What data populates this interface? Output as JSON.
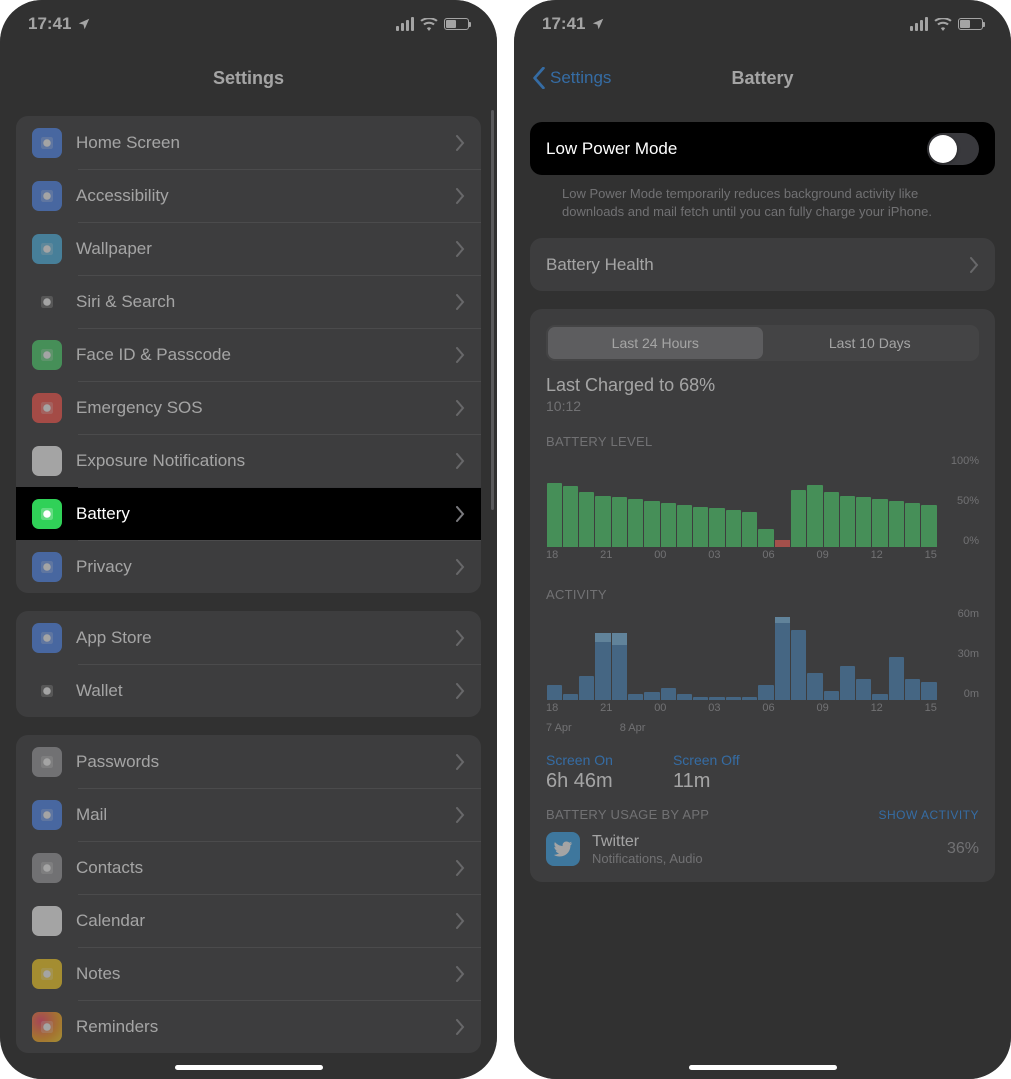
{
  "status": {
    "time": "17:41"
  },
  "left": {
    "title": "Settings",
    "groups": [
      [
        {
          "label": "Home Screen",
          "iconName": "home-screen-icon",
          "iconClass": "ic-blue",
          "selected": false
        },
        {
          "label": "Accessibility",
          "iconName": "accessibility-icon",
          "iconClass": "ic-blue",
          "selected": false
        },
        {
          "label": "Wallpaper",
          "iconName": "wallpaper-icon",
          "iconClass": "ic-cyan",
          "selected": false
        },
        {
          "label": "Siri & Search",
          "iconName": "siri-icon",
          "iconClass": "ic-dark",
          "selected": false
        },
        {
          "label": "Face ID & Passcode",
          "iconName": "faceid-icon",
          "iconClass": "ic-green",
          "selected": false
        },
        {
          "label": "Emergency SOS",
          "iconName": "sos-icon",
          "iconClass": "ic-red",
          "selected": false
        },
        {
          "label": "Exposure Notifications",
          "iconName": "exposure-icon",
          "iconClass": "ic-white",
          "selected": false
        },
        {
          "label": "Battery",
          "iconName": "battery-icon",
          "iconClass": "ic-green",
          "selected": true
        },
        {
          "label": "Privacy",
          "iconName": "privacy-icon",
          "iconClass": "ic-blue",
          "selected": false
        }
      ],
      [
        {
          "label": "App Store",
          "iconName": "appstore-icon",
          "iconClass": "ic-blue",
          "selected": false
        },
        {
          "label": "Wallet",
          "iconName": "wallet-icon",
          "iconClass": "ic-dark",
          "selected": false
        }
      ],
      [
        {
          "label": "Passwords",
          "iconName": "passwords-icon",
          "iconClass": "ic-grey",
          "selected": false
        },
        {
          "label": "Mail",
          "iconName": "mail-icon",
          "iconClass": "ic-blue",
          "selected": false
        },
        {
          "label": "Contacts",
          "iconName": "contacts-icon",
          "iconClass": "ic-grey",
          "selected": false
        },
        {
          "label": "Calendar",
          "iconName": "calendar-icon",
          "iconClass": "ic-white",
          "selected": false
        },
        {
          "label": "Notes",
          "iconName": "notes-icon",
          "iconClass": "ic-yellow",
          "selected": false
        },
        {
          "label": "Reminders",
          "iconName": "reminders-icon",
          "iconClass": "ic-multi",
          "selected": false
        }
      ]
    ]
  },
  "right": {
    "backLabel": "Settings",
    "title": "Battery",
    "lowPower": {
      "label": "Low Power Mode",
      "on": false
    },
    "lowPowerFootnote": "Low Power Mode temporarily reduces background activity like downloads and mail fetch until you can fully charge your iPhone.",
    "batteryHealth": "Battery Health",
    "segments": {
      "a": "Last 24 Hours",
      "b": "Last 10 Days",
      "selected": "a"
    },
    "lastCharged": {
      "headline": "Last Charged to 68%",
      "time": "10:12"
    },
    "batteryLevelLabel": "BATTERY LEVEL",
    "activityLabel": "ACTIVITY",
    "yTicksBattery": [
      "100%",
      "50%",
      "0%"
    ],
    "yTicksActivity": [
      "60m",
      "30m",
      "0m"
    ],
    "xTicks": [
      "18",
      "21",
      "00",
      "03",
      "06",
      "09",
      "12",
      "15"
    ],
    "subDates": [
      "7 Apr",
      "8 Apr"
    ],
    "screenOn": {
      "label": "Screen On",
      "value": "6h 46m"
    },
    "screenOff": {
      "label": "Screen Off",
      "value": "11m"
    },
    "usageHead": "BATTERY USAGE BY APP",
    "showActivity": "SHOW ACTIVITY",
    "apps": [
      {
        "name": "Twitter",
        "sub": "Notifications, Audio",
        "pct": "36%"
      }
    ]
  },
  "chart_data": [
    {
      "type": "bar",
      "title": "BATTERY LEVEL",
      "ylabel": "%",
      "ylim": [
        0,
        100
      ],
      "categories": [
        "18",
        "19",
        "20",
        "21",
        "22",
        "23",
        "00",
        "01",
        "02",
        "03",
        "04",
        "05",
        "06",
        "07",
        "08",
        "09",
        "10",
        "11",
        "12",
        "13",
        "14",
        "15",
        "16",
        "17"
      ],
      "values": [
        70,
        66,
        60,
        56,
        54,
        52,
        50,
        48,
        46,
        44,
        42,
        40,
        38,
        20,
        8,
        62,
        68,
        60,
        56,
        54,
        52,
        50,
        48,
        46
      ],
      "annotations": {
        "low_battery_hours": [
          "08"
        ],
        "charging_window": "08-10"
      }
    },
    {
      "type": "bar",
      "title": "ACTIVITY",
      "ylabel": "minutes",
      "ylim": [
        0,
        60
      ],
      "categories": [
        "18",
        "19",
        "20",
        "21",
        "22",
        "23",
        "00",
        "01",
        "02",
        "03",
        "04",
        "05",
        "06",
        "07",
        "08",
        "09",
        "10",
        "11",
        "12",
        "13",
        "14",
        "15",
        "16",
        "17"
      ],
      "series": [
        {
          "name": "Screen On",
          "values": [
            10,
            4,
            16,
            38,
            36,
            4,
            5,
            8,
            4,
            2,
            2,
            2,
            2,
            10,
            50,
            46,
            18,
            6,
            22,
            14,
            4,
            28,
            14,
            12
          ]
        },
        {
          "name": "Screen Off",
          "values": [
            0,
            0,
            0,
            6,
            8,
            0,
            0,
            0,
            0,
            0,
            0,
            0,
            0,
            0,
            4,
            0,
            0,
            0,
            0,
            0,
            0,
            0,
            0,
            0
          ]
        }
      ]
    }
  ]
}
